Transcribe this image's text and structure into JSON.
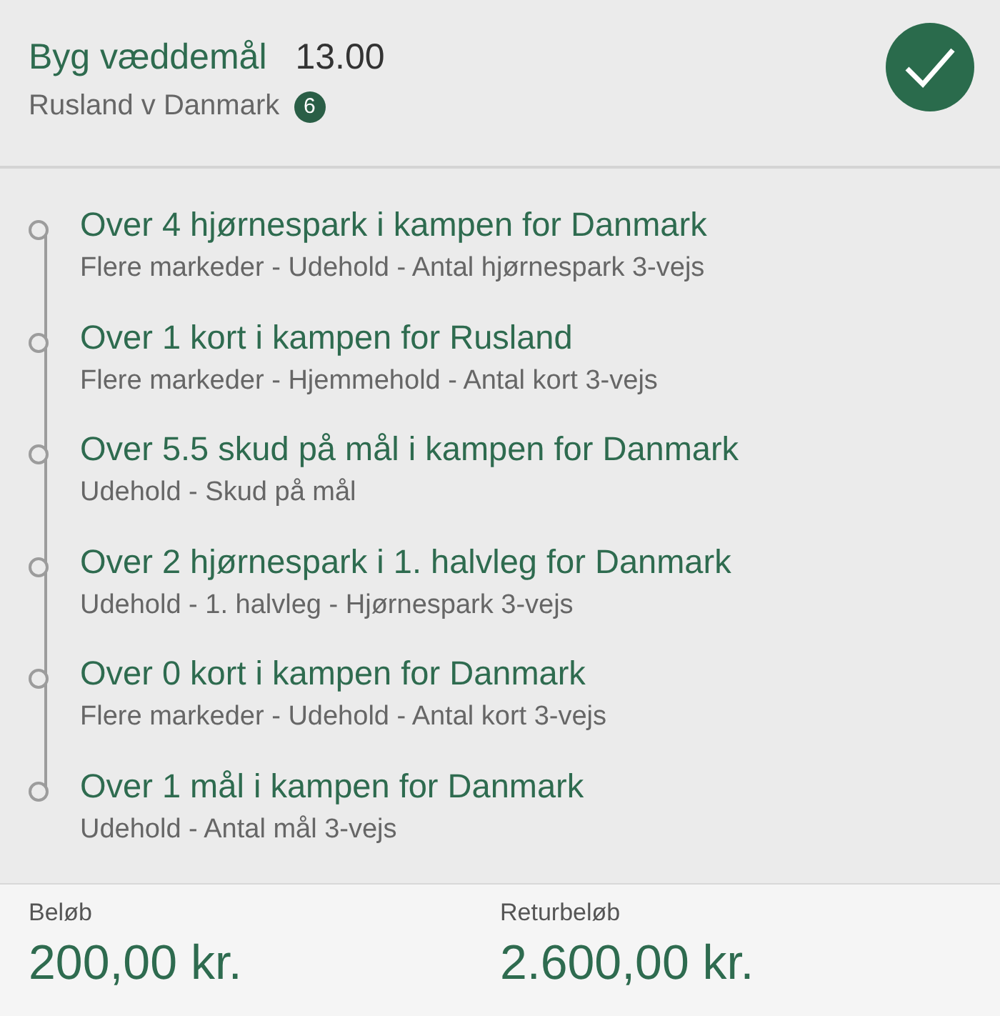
{
  "header": {
    "title": "Byg væddemål",
    "odds": "13.00",
    "match": "Rusland v Danmark",
    "count": "6",
    "confirmed": true
  },
  "selections": [
    {
      "title": "Over 4 hjørnespark i kampen for Danmark",
      "detail": "Flere markeder - Udehold - Antal hjørnespark 3-vejs"
    },
    {
      "title": "Over 1 kort i kampen for Rusland",
      "detail": "Flere markeder - Hjemmehold - Antal kort 3-vejs"
    },
    {
      "title": "Over 5.5 skud på mål i kampen for Danmark",
      "detail": "Udehold - Skud på mål"
    },
    {
      "title": "Over 2 hjørnespark i 1. halvleg for Danmark",
      "detail": "Udehold - 1. halvleg - Hjørnespark 3-vejs"
    },
    {
      "title": "Over 0 kort i kampen for Danmark",
      "detail": "Flere markeder - Udehold - Antal kort 3-vejs"
    },
    {
      "title": "Over 1 mål i kampen for Danmark",
      "detail": "Udehold - Antal mål 3-vejs"
    }
  ],
  "footer": [
    {
      "label": "Beløb",
      "value": "200,00 kr."
    },
    {
      "label": "Returbeløb",
      "value": "2.600,00 kr."
    }
  ]
}
